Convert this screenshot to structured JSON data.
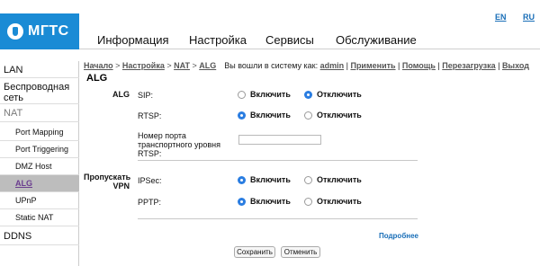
{
  "brand": {
    "name": "МГТС"
  },
  "lang": [
    "EN",
    "RU"
  ],
  "topnav": [
    "Информация",
    "Настройка",
    "Сервисы",
    "Обслуживание"
  ],
  "sidebar": {
    "lan": "LAN",
    "wireless": "Беспроводная сеть",
    "nat": "NAT",
    "port_mapping": "Port Mapping",
    "port_triggering": "Port Triggering",
    "dmz": "DMZ Host",
    "alg": "ALG",
    "upnp": "UPnP",
    "static_nat": "Static NAT",
    "ddns": "DDNS"
  },
  "breadcrumb": {
    "home": "Начало",
    "settings": "Настройка",
    "nat": "NAT",
    "alg": "ALG",
    "sep": " > "
  },
  "login": {
    "text": "Вы вошли в систему как:",
    "user": "admin",
    "apply": "Применить",
    "help": "Помощь",
    "reboot": "Перезагрузка",
    "logout": "Выход"
  },
  "page": {
    "title": "ALG"
  },
  "alg": {
    "group": "ALG",
    "sip": {
      "label": "SIP:",
      "value": "off"
    },
    "rtsp": {
      "label": "RTSP:",
      "value": "on"
    },
    "rtsp_port": {
      "label": "Номер порта транспортного уровня RTSP:",
      "value": ""
    }
  },
  "vpn": {
    "group": "Пропускать VPN",
    "ipsec": {
      "label": "IPSec:",
      "value": "on"
    },
    "pptp": {
      "label": "PPTP:",
      "value": "on"
    }
  },
  "options": {
    "on": "Включить",
    "off": "Отключить"
  },
  "more": "Подробнее",
  "buttons": {
    "save": "Сохранить",
    "cancel": "Отменить"
  }
}
